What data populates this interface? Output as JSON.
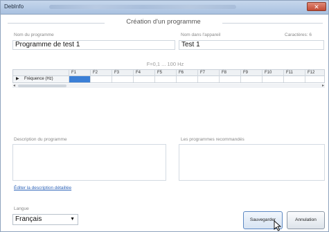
{
  "window": {
    "title": "DebInfo",
    "close_label": "✕"
  },
  "section": {
    "title": "Création d'un programme"
  },
  "fields": {
    "program_name_label": "Nom du programme",
    "program_name_value": "Programme de test 1",
    "device_name_label": "Nom dans l'appareil",
    "device_name_value": "Test 1",
    "chars_label": "Caractères: 6"
  },
  "frequency": {
    "range_label": "F=0,1 ... 100 Hz",
    "columns": [
      "F1",
      "F2",
      "F3",
      "F4",
      "F5",
      "F6",
      "F7",
      "F8",
      "F9",
      "F10",
      "F11",
      "F12"
    ],
    "row_label": "Fréquence (Hz)",
    "values": [
      "",
      "",
      "",
      "",
      "",
      "",
      "",
      "",
      "",
      "",
      "",
      ""
    ],
    "selected_index": 0
  },
  "description": {
    "label": "Description du programme",
    "value": ""
  },
  "recommended": {
    "label": "Les programmes recommandés",
    "value": ""
  },
  "edit_link": "Éditer la description détaillée",
  "language": {
    "label": "Langue",
    "selected": "Français"
  },
  "buttons": {
    "save": "Sauvegarder",
    "cancel": "Annulation"
  }
}
